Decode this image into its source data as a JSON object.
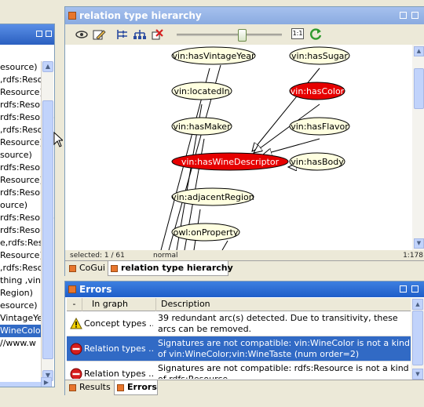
{
  "left_panel": {
    "items": [
      "esource)",
      ",rdfs:Resour",
      "Resource)",
      "rdfs:Resour",
      "rdfs:Resource",
      ",rdfs:Reso",
      "Resource)",
      "source)",
      "rdfs:Resour",
      "Resource)",
      "rdfs:Resour",
      "ource)",
      "rdfs:Resource",
      "rdfs:Resourc",
      "e,rdfs:Res",
      "Resource)",
      ",rdfs:Reso",
      "thing ,vin:",
      "Region)",
      "esource)",
      "VintageYe",
      "WineColor;vin",
      "//www.w"
    ],
    "selected_index": 21
  },
  "graph_window": {
    "title": "relation type hierarchy",
    "toolbar": {
      "tools": [
        "eye-icon",
        "edit-icon",
        "tree-layout-icon",
        "hierarchy-layout-icon",
        "clear-icon"
      ],
      "zoom_level": 0.62,
      "zoom_reset_label": "1:1"
    },
    "nodes": [
      {
        "label": "vin:hasVintageYear",
        "highlight": false
      },
      {
        "label": "vin:hasSugar",
        "highlight": false
      },
      {
        "label": "vin:locatedIn",
        "highlight": false
      },
      {
        "label": "vin:hasColor",
        "highlight": true
      },
      {
        "label": "vin:hasMaker",
        "highlight": false
      },
      {
        "label": "vin:hasFlavor",
        "highlight": false
      },
      {
        "label": "vin:hasWineDescriptor",
        "highlight": true
      },
      {
        "label": "vin:hasBody",
        "highlight": false
      },
      {
        "label": "vin:adjacentRegion",
        "highlight": false
      },
      {
        "label": "owl:onProperty",
        "highlight": false
      }
    ],
    "status": {
      "selected": "selected: 1 / 61",
      "mode": "normal",
      "zoom": "1:178"
    },
    "tabs": [
      {
        "label": "CoGui",
        "active": false
      },
      {
        "label": "relation type hierarchy",
        "active": true
      }
    ]
  },
  "errors_window": {
    "title": "Errors",
    "columns": [
      "-",
      "In graph",
      "Description"
    ],
    "rows": [
      {
        "icon": "warning-icon",
        "in_graph": "Concept types ...",
        "description": "39 redundant arc(s) detected. Due to transitivity, these arcs can be removed.",
        "selected": false
      },
      {
        "icon": "error-icon",
        "in_graph": "Relation types ...",
        "description": "Signatures are not compatible: vin:WineColor is not a kind of vin:WineColor;vin:WineTaste (num order=2)",
        "selected": true
      },
      {
        "icon": "error-icon",
        "in_graph": "Relation types ...",
        "description": "Signatures are not compatible: rdfs:Resource is not a kind of rdfs:Resource",
        "selected": false
      }
    ],
    "tabs": [
      {
        "label": "Results",
        "active": false
      },
      {
        "label": "Errors",
        "active": true
      }
    ]
  },
  "colors": {
    "highlight_node": "#e60000",
    "normal_node": "#ffffe0",
    "selection": "#316ac5"
  }
}
